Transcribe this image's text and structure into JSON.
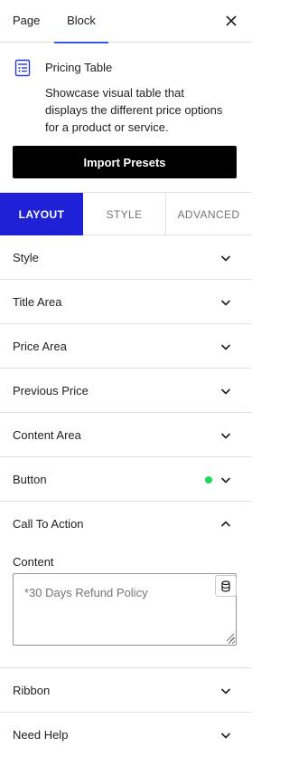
{
  "header": {
    "tabs": [
      "Page",
      "Block"
    ],
    "active_tab": "Block",
    "close_icon": "close-icon"
  },
  "block_card": {
    "icon": "pricing-table-icon",
    "title": "Pricing Table",
    "description": "Showcase visual table that displays the different price options for a product or service."
  },
  "import_button": {
    "label": "Import Presets"
  },
  "segment_tabs": {
    "items": [
      "LAYOUT",
      "STYLE",
      "ADVANCED"
    ],
    "active": "LAYOUT",
    "active_color": "#1e21d6"
  },
  "panels": [
    {
      "label": "Style",
      "state": "collapsed"
    },
    {
      "label": "Title Area",
      "state": "collapsed"
    },
    {
      "label": "Price Area",
      "state": "collapsed"
    },
    {
      "label": "Previous Price",
      "state": "collapsed"
    },
    {
      "label": "Content Area",
      "state": "collapsed"
    },
    {
      "label": "Button",
      "state": "collapsed",
      "indicator_color": "#1ed760"
    },
    {
      "label": "Call To Action",
      "state": "expanded"
    },
    {
      "label": "Ribbon",
      "state": "collapsed"
    },
    {
      "label": "Need Help",
      "state": "collapsed"
    }
  ],
  "call_to_action": {
    "content_label": "Content",
    "content_placeholder": "*30 Days Refund Policy",
    "dynamic_icon": "database-icon"
  }
}
